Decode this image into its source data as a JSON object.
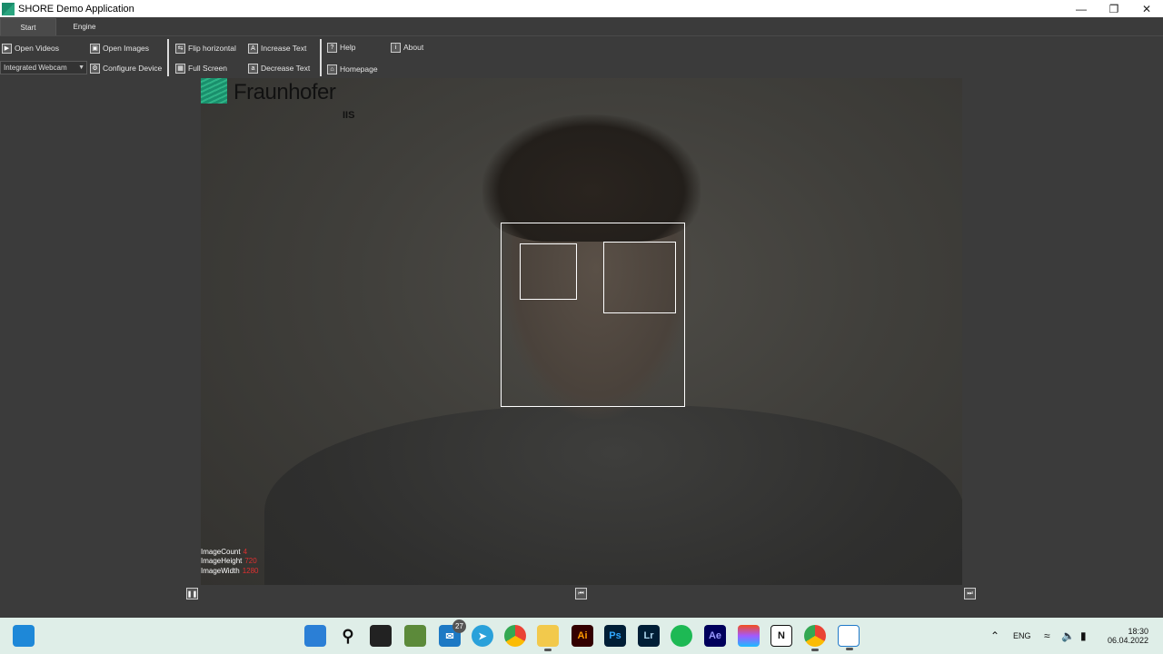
{
  "window": {
    "title": "SHORE Demo Application"
  },
  "tabs": [
    {
      "label": "Start"
    },
    {
      "label": "Engine"
    }
  ],
  "ribbon": {
    "open_videos": "Open Videos",
    "open_images": "Open Images",
    "device_select": "Integrated Webcam",
    "configure_device": "Configure Device",
    "flip_horizontal": "Flip horizontal",
    "full_screen": "Full Screen",
    "increase_text": "Increase Text",
    "decrease_text": "Decrease Text",
    "help": "Help",
    "homepage": "Homepage",
    "about": "About"
  },
  "logo": {
    "brand": "Fraunhofer",
    "sub": "IIS"
  },
  "overlay": {
    "rows": [
      {
        "label": "ImageCount",
        "value": "4"
      },
      {
        "label": "ImageHeight",
        "value": "720"
      },
      {
        "label": "ImageWidth",
        "value": "1280"
      }
    ]
  },
  "taskbar": {
    "mail_badge": "27",
    "lang": "ENG",
    "time": "18:30",
    "date": "06.04.2022",
    "icons": [
      "start-icon",
      "search-icon",
      "task-view-icon",
      "app-icon",
      "mail-icon",
      "telegram-icon",
      "chrome-icon",
      "folder-icon",
      "illustrator-icon",
      "photoshop-icon",
      "lightroom-icon",
      "spotify-icon",
      "after-effects-icon",
      "figma-icon",
      "notion-icon",
      "chrome-icon",
      "shore-app-icon"
    ]
  },
  "colors": {
    "accent": "#1a8f6c",
    "overlay_value": "#e03030"
  }
}
